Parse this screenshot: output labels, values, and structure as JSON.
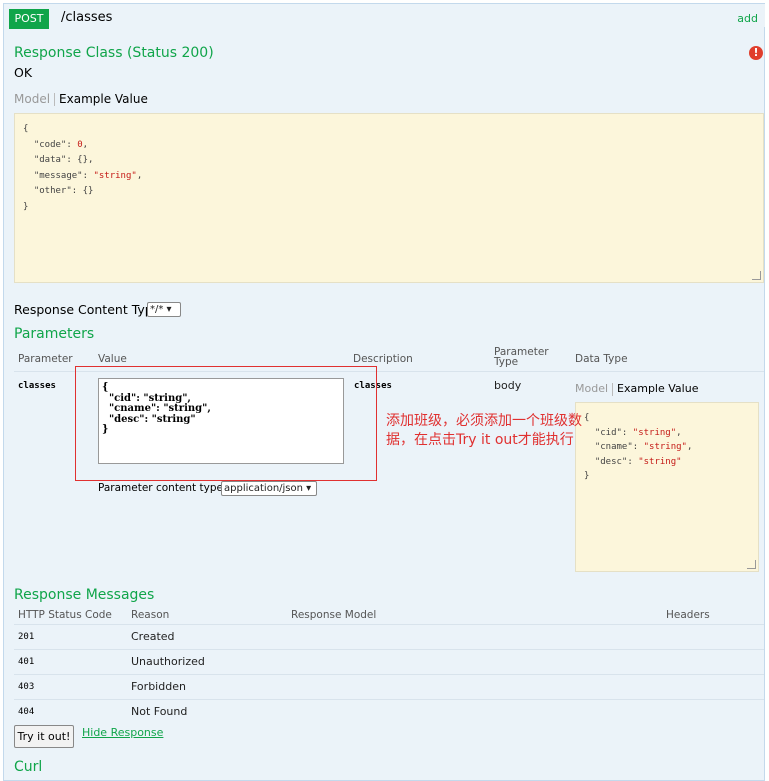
{
  "header": {
    "method": "POST",
    "path": "/classes",
    "action": "add"
  },
  "response_class": {
    "title": "Response Class (Status 200)",
    "status_text": "OK",
    "error_icon": "!",
    "tab_model": "Model",
    "tab_example": "Example Value"
  },
  "response_example": {
    "l1": "{",
    "l2k": "  \"code\": ",
    "l2v": "0",
    "l2e": ",",
    "l3k": "  \"data\": {},",
    "l4k": "  \"message\": ",
    "l4v": "\"string\"",
    "l4e": ",",
    "l5k": "  \"other\": {}",
    "l6": "}"
  },
  "content_type": {
    "label": "Response Content Type",
    "selected": "*/* ▾"
  },
  "parameters": {
    "title": "Parameters",
    "headers": {
      "parameter": "Parameter",
      "value": "Value",
      "description": "Description",
      "param_type": "Parameter Type",
      "data_type": "Data Type"
    },
    "row": {
      "name": "classes",
      "value": "{\n  \"cid\": \"string\",\n  \"cname\": \"string\",\n  \"desc\": \"string\"\n}",
      "description": "classes",
      "type": "body",
      "tab_model": "Model",
      "tab_example": "Example Value",
      "content_type_label": "Parameter content type:",
      "content_type_value": "application/json ▾"
    },
    "example": {
      "l1": "{",
      "l2k": "  \"cid\": ",
      "l2v": "\"string\"",
      "l2e": ",",
      "l3k": "  \"cname\": ",
      "l3v": "\"string\"",
      "l3e": ",",
      "l4k": "  \"desc\": ",
      "l4v": "\"string\"",
      "l5": "}"
    }
  },
  "annotation": "添加班级，必须添加一个班级数据，在点击Try it out才能执行",
  "response_messages": {
    "title": "Response Messages",
    "headers": {
      "code": "HTTP Status Code",
      "reason": "Reason",
      "model": "Response Model",
      "headers": "Headers"
    },
    "rows": [
      {
        "code": "201",
        "reason": "Created"
      },
      {
        "code": "401",
        "reason": "Unauthorized"
      },
      {
        "code": "403",
        "reason": "Forbidden"
      },
      {
        "code": "404",
        "reason": "Not Found"
      }
    ]
  },
  "actions": {
    "try_label": "Try it out!",
    "hide_label": "Hide Response"
  },
  "curl": {
    "title": "Curl"
  },
  "colors": {
    "accent": "#10a54a",
    "code_bg": "#fcf6db",
    "annotation": "#e03030",
    "error": "#e03e2d"
  }
}
